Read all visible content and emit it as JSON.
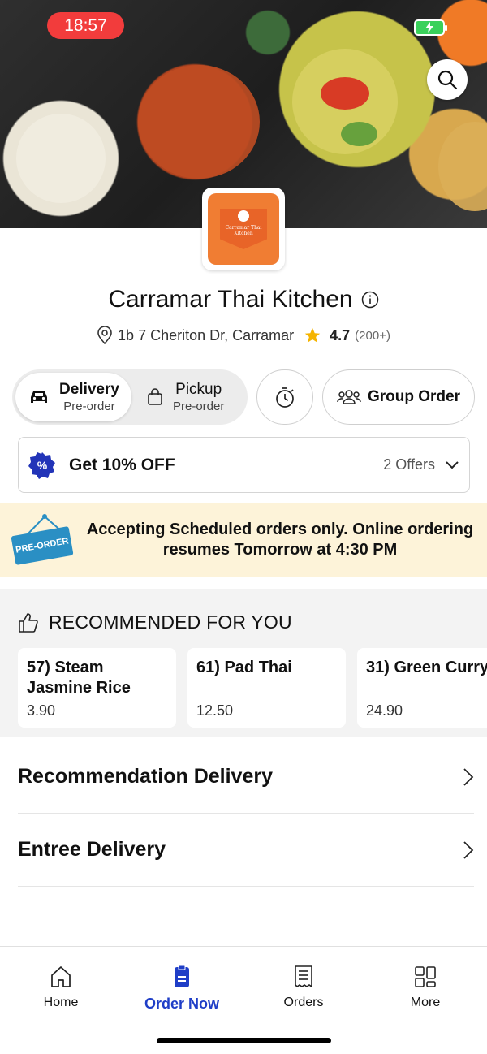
{
  "status": {
    "time": "18:57"
  },
  "restaurant": {
    "name": "Carramar Thai Kitchen",
    "logo_text": "Carramar Thai Kitchen",
    "address": "1b 7 Cheriton Dr, Carramar",
    "rating": "4.7",
    "rating_count": "(200+)"
  },
  "modes": [
    {
      "title": "Delivery",
      "subtitle": "Pre-order",
      "selected": true
    },
    {
      "title": "Pickup",
      "subtitle": "Pre-order",
      "selected": false
    }
  ],
  "group_order_label": "Group Order",
  "offer": {
    "title": "Get 10% OFF",
    "count": "2 Offers"
  },
  "banner": {
    "tag": "PRE-ORDER",
    "text": "Accepting Scheduled orders only. Online ordering resumes Tomorrow at 4:30 PM"
  },
  "recommended": {
    "heading": "RECOMMENDED FOR YOU",
    "items": [
      {
        "name": "57) Steam Jasmine Rice",
        "price": "3.90"
      },
      {
        "name": "61) Pad Thai",
        "price": "12.50"
      },
      {
        "name": "31) Green Curry",
        "price": "24.90"
      }
    ]
  },
  "categories": [
    {
      "title": "Recommendation Delivery"
    },
    {
      "title": "Entree Delivery"
    }
  ],
  "nav": [
    {
      "label": "Home",
      "icon": "home-icon"
    },
    {
      "label": "Order Now",
      "icon": "order-icon",
      "active": true
    },
    {
      "label": "Orders",
      "icon": "receipt-icon"
    },
    {
      "label": "More",
      "icon": "grid-icon"
    }
  ],
  "colors": {
    "accent": "#1f3ec7",
    "status_red": "#f23c3c",
    "banner_bg": "#fdf3d9",
    "logo_orange": "#f07d33"
  }
}
